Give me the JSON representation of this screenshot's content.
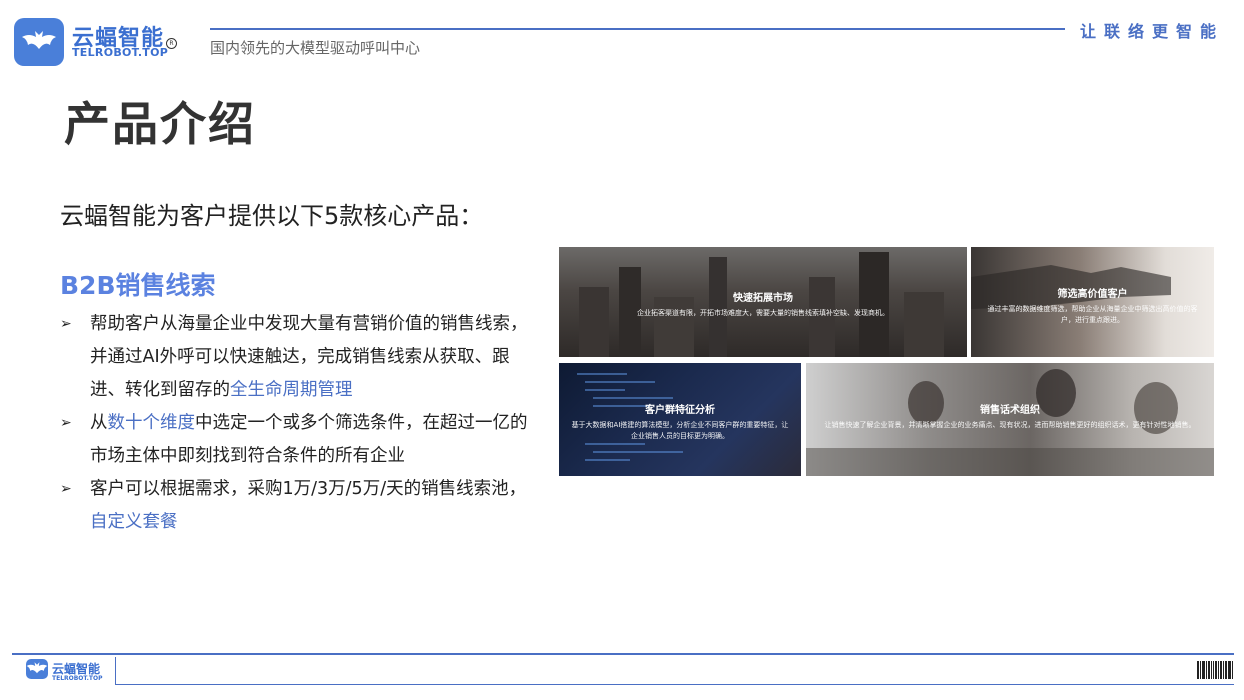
{
  "header": {
    "logo_cn": "云蝠智能",
    "logo_en": "TELROBOT.TOP",
    "logo_reg": "R",
    "tagline": "国内领先的大模型驱动呼叫中心",
    "slogan": "让联络更智能"
  },
  "page_title": "产品介绍",
  "intro": "云蝠智能为客户提供以下5款核心产品：",
  "section": {
    "title": "B2B销售线索",
    "bullet_marker": "➢",
    "bullets": [
      {
        "before": "帮助客户从海量企业中发现大量有营销价值的销售线索，并通过AI外呼可以快速触达，完成销售线索从获取、跟进、转化到留存的",
        "highlight": "全生命周期管理",
        "after": ""
      },
      {
        "before": "从",
        "highlight": "数十个维度",
        "after": "中选定一个或多个筛选条件，在超过一亿的市场主体中即刻找到符合条件的所有企业"
      },
      {
        "before": "客户可以根据需求，采购1万/3万/5万/天的销售线索池，",
        "highlight": "自定义套餐",
        "after": ""
      }
    ]
  },
  "tiles": [
    {
      "title": "快速拓展市场",
      "desc": "企业拓客渠道有限，开拓市场难度大，需要大量的销售线索填补空缺、发现商机。"
    },
    {
      "title": "筛选高价值客户",
      "desc": "通过丰富的数据维度筛选，帮助企业从海量企业中筛选出高价值的客户，进行重点跟进。"
    },
    {
      "title": "客户群特征分析",
      "desc": "基于大数据和AI搭建的算法模型，分析企业不同客户群的重要特征，让企业销售人员的目标更为明确。"
    },
    {
      "title": "销售话术组织",
      "desc": "让销售快速了解企业背景，并清晰掌握企业的业务痛点、现有状况，进而帮助销售更好的组织话术，更有针对性地销售。"
    }
  ],
  "footer": {
    "logo_cn": "云蝠智能",
    "logo_en": "TELROBOT.TOP"
  },
  "colors": {
    "accent": "#4a6fc4",
    "section_title": "#5b82e0",
    "logo": "#4a7fd9"
  }
}
